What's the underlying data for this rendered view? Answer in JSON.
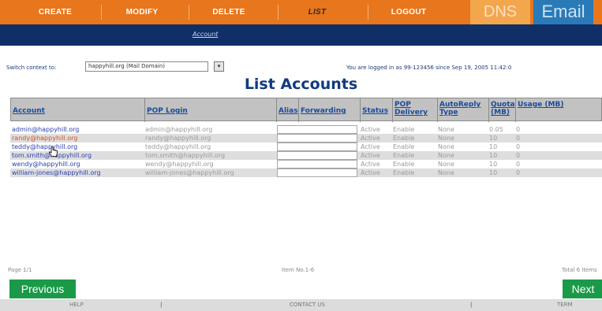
{
  "topnav": {
    "items": [
      {
        "label": "CREATE"
      },
      {
        "label": "MODIFY"
      },
      {
        "label": "DELETE"
      },
      {
        "label": "LIST"
      },
      {
        "label": "LOGOUT"
      }
    ],
    "active_index": 3,
    "accent": "#e8761c",
    "brand_dns": "DNS",
    "brand_email": "Email"
  },
  "subnav": {
    "link": "Account",
    "bg": "#0f2f66"
  },
  "context": {
    "label": "Switch context to:",
    "selected": "happyhill.org (Mail Domain)",
    "arrow": "▾"
  },
  "login_info": "You are logged in as 99-123456 since Sep 19, 2005 11:42:0",
  "title": "List Accounts",
  "table": {
    "headers": {
      "account": "Account",
      "pop_login": "POP Login",
      "alias": "Alias",
      "forwarding": "Forwarding",
      "status": "Status",
      "pop_delivery": "POP Delivery",
      "autoreply": "AutoReply Type",
      "quota": "Quota (MB)",
      "usage": "Usage (MB)"
    },
    "rows": [
      {
        "account": "admin@happyhill.org",
        "pop_login": "admin@happyhill.org",
        "status": "Active",
        "pop_delivery": "Enable",
        "autoreply": "None",
        "quota": "0.05",
        "usage": "0"
      },
      {
        "account": "randy@happyhill.org",
        "pop_login": "randy@happyhill.org",
        "status": "Active",
        "pop_delivery": "Enable",
        "autoreply": "None",
        "quota": "10",
        "usage": "0"
      },
      {
        "account": "teddy@happyhill.org",
        "pop_login": "teddy@happyhill.org",
        "status": "Active",
        "pop_delivery": "Enable",
        "autoreply": "None",
        "quota": "10",
        "usage": "0"
      },
      {
        "account": "tom.smith@happyhill.org",
        "pop_login": "tom.smith@happyhill.org",
        "status": "Active",
        "pop_delivery": "Enable",
        "autoreply": "None",
        "quota": "10",
        "usage": "0"
      },
      {
        "account": "wendy@happyhill.org",
        "pop_login": "wendy@happyhill.org",
        "status": "Active",
        "pop_delivery": "Enable",
        "autoreply": "None",
        "quota": "10",
        "usage": "0"
      },
      {
        "account": "william-jones@happyhill.org",
        "pop_login": "william-jones@happyhill.org",
        "status": "Active",
        "pop_delivery": "Enable",
        "autoreply": "None",
        "quota": "10",
        "usage": "0"
      }
    ]
  },
  "pagination": {
    "page": "Page 1/1",
    "items": "Item No.1-6",
    "total": "Total 6 Items",
    "prev": "Previous",
    "next": "Next"
  },
  "footer": {
    "help": "HELP",
    "contact": "CONTACT US",
    "term": "TERM",
    "sep": "|"
  }
}
